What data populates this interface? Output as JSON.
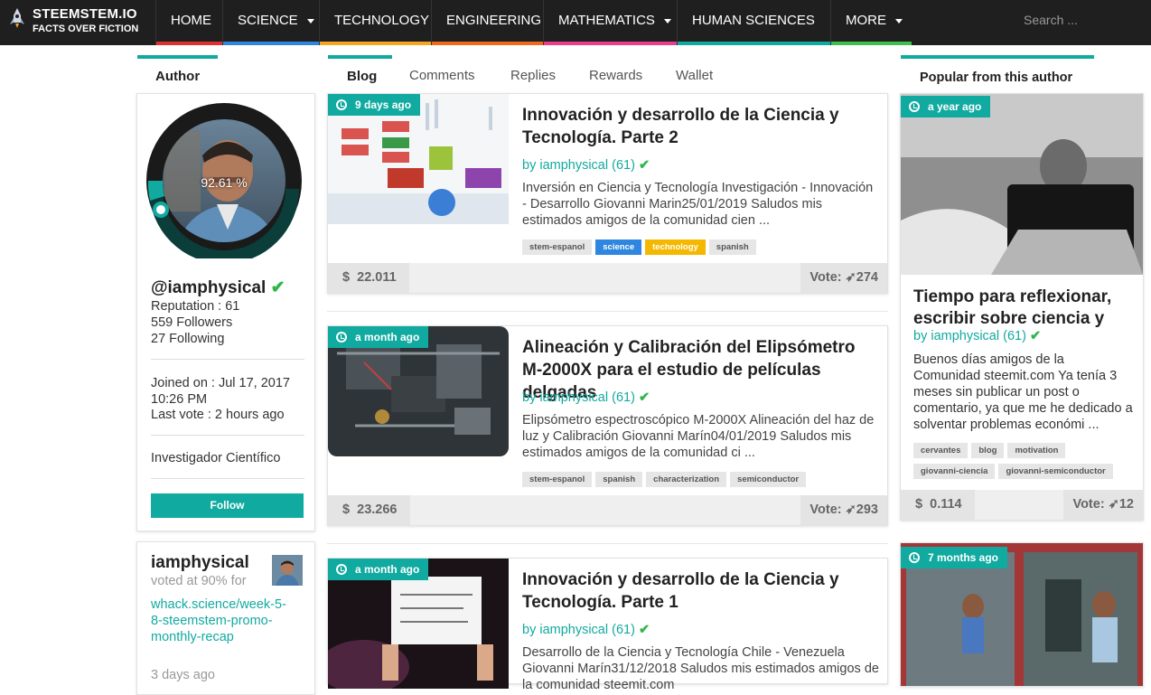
{
  "nav": {
    "brand_line1": "STEEMSTEM.IO",
    "brand_line2": "FACTS OVER FICTION",
    "items": [
      {
        "label": "HOME",
        "color": "#e03131"
      },
      {
        "label": "SCIENCE",
        "color": "#2f86e0"
      },
      {
        "label": "TECHNOLOGY",
        "color": "#f5a623"
      },
      {
        "label": "ENGINEERING",
        "color": "#f06a1d"
      },
      {
        "label": "MATHEMATICS",
        "color": "#e83e8c"
      },
      {
        "label": "HUMAN SCIENCES",
        "color": "#11aaa0"
      },
      {
        "label": "MORE",
        "color": "#3cc24b"
      }
    ],
    "search_placeholder": "Search ..."
  },
  "author_panel": {
    "header": "Author",
    "vp_percent": "92.61 %",
    "username": "@iamphysical",
    "reputation": "Reputation : 61",
    "followers": "559 Followers",
    "following": "27 Following",
    "joined": "Joined on : Jul 17, 2017 10:26 PM",
    "last_vote": "Last vote : 2 hours ago",
    "bio": "Investigador Científico",
    "follow_label": "Follow"
  },
  "vote_card": {
    "name": "iamphysical",
    "action": "voted at 90% for",
    "link": "whack.science/week-5-8-steemstem-promo-monthly-recap",
    "time": "3 days ago"
  },
  "tabs": [
    "Blog",
    "Comments",
    "Replies",
    "Rewards",
    "Wallet"
  ],
  "posts": [
    {
      "age": "9 days ago",
      "title": "Innovación y desarrollo de la Ciencia y Tecnología. Parte 2",
      "author": "by iamphysical (61)",
      "excerpt": "Inversión en Ciencia y Tecnología Investigación - Innovación - Desarrollo Giovanni Marin25/01/2019 Saludos mis estimados amigos de la comunidad cien ...",
      "tags": [
        {
          "label": "stem-espanol",
          "bg": "#e6e6e6",
          "fg": "#555"
        },
        {
          "label": "science",
          "bg": "#2f86e0",
          "fg": "#fff"
        },
        {
          "label": "technology",
          "bg": "#f5b800",
          "fg": "#fff"
        },
        {
          "label": "spanish",
          "bg": "#e6e6e6",
          "fg": "#555"
        }
      ],
      "payout": "22.011",
      "votes": "274"
    },
    {
      "age": "a month ago",
      "title": "Alineación y Calibración del Elipsómetro M-2000X para el estudio de películas delgadas",
      "author": "by iamphysical (61)",
      "excerpt": "Elipsómetro espectroscópico M-2000X Alineación del haz de luz y Calibración Giovanni Marín04/01/2019 Saludos mis estimados amigos de la comunidad ci ...",
      "tags": [
        {
          "label": "stem-espanol",
          "bg": "#e6e6e6",
          "fg": "#555"
        },
        {
          "label": "spanish",
          "bg": "#e6e6e6",
          "fg": "#555"
        },
        {
          "label": "characterization",
          "bg": "#e6e6e6",
          "fg": "#555"
        },
        {
          "label": "semiconductor",
          "bg": "#e6e6e6",
          "fg": "#555"
        }
      ],
      "payout": "23.266",
      "votes": "293"
    },
    {
      "age": "a month ago",
      "title": "Innovación y desarrollo de la Ciencia y Tecnología. Parte 1",
      "author": "by iamphysical (61)",
      "excerpt": "Desarrollo de la Ciencia y Tecnología Chile - Venezuela Giovanni Marín31/12/2018 Saludos mis estimados amigos de la comunidad steemit.com",
      "tags": [],
      "payout": "",
      "votes": ""
    }
  ],
  "popular": {
    "header": "Popular from this author",
    "items": [
      {
        "age": "a year ago",
        "title": "Tiempo para reflexionar, escribir sobre ciencia y",
        "author": "by iamphysical (61)",
        "excerpt": "Buenos días amigos de la Comunidad steemit.com Ya tenía 3 meses sin publicar un post o comentario, ya que me he dedicado a solventar problemas económi ...",
        "tags": [
          "cervantes",
          "blog",
          "motivation",
          "giovanni-ciencia",
          "giovanni-semiconductor"
        ],
        "payout": "0.114",
        "votes": "12"
      },
      {
        "age": "7 months ago"
      }
    ]
  },
  "labels": {
    "dollar": "$",
    "vote_prefix": "Vote:"
  }
}
